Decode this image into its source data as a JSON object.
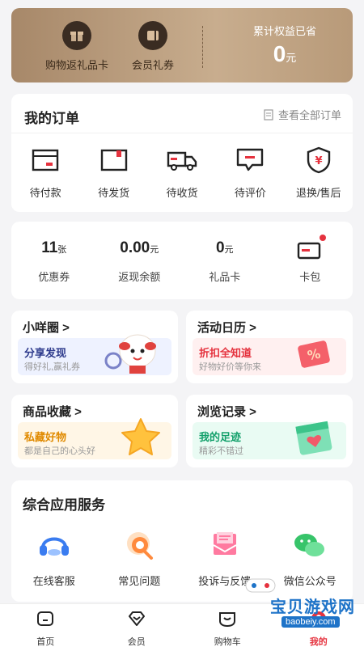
{
  "benefits": {
    "items": [
      {
        "label": "购物返礼品卡",
        "icon": "gift-icon"
      },
      {
        "label": "会员礼券",
        "icon": "coupon-icon"
      }
    ],
    "total_label": "累计权益已省",
    "total_value": "0",
    "total_unit": "元"
  },
  "orders": {
    "title": "我的订单",
    "view_all": "查看全部订单",
    "statuses": [
      {
        "label": "待付款",
        "icon": "wallet-icon"
      },
      {
        "label": "待发货",
        "icon": "package-icon"
      },
      {
        "label": "待收货",
        "icon": "truck-icon"
      },
      {
        "label": "待评价",
        "icon": "comment-icon"
      },
      {
        "label": "退换/售后",
        "icon": "shield-yen-icon"
      }
    ]
  },
  "assets": {
    "coupons": {
      "value": "11",
      "unit": "张",
      "label": "优惠券"
    },
    "cashback": {
      "value": "0.00",
      "unit": "元",
      "label": "返现余额"
    },
    "giftcard": {
      "value": "0",
      "unit": "元",
      "label": "礼品卡"
    },
    "wallet": {
      "label": "卡包"
    }
  },
  "tiles": [
    {
      "title": "小咩圈 >",
      "headline": "分享发现",
      "sub": "得好礼,赢礼券",
      "bg": "#eef2ff",
      "hcolor": "#2d3a8c"
    },
    {
      "title": "活动日历 >",
      "headline": "折扣全知道",
      "sub": "好物好价等你来",
      "bg": "#fff0f0",
      "hcolor": "#e5323e"
    },
    {
      "title": "商品收藏 >",
      "headline": "私藏好物",
      "sub": "都是自己的心头好",
      "bg": "#fff6e6",
      "hcolor": "#e08a00"
    },
    {
      "title": "浏览记录 >",
      "headline": "我的足迹",
      "sub": "精彩不错过",
      "bg": "#e9fbf3",
      "hcolor": "#13a06b"
    }
  ],
  "services": {
    "title": "综合应用服务",
    "items": [
      {
        "label": "在线客服",
        "icon": "headset-icon"
      },
      {
        "label": "常见问题",
        "icon": "faq-icon"
      },
      {
        "label": "投诉与反馈",
        "icon": "feedback-icon"
      },
      {
        "label": "微信公众号",
        "icon": "wechat-icon"
      }
    ]
  },
  "tabbar": {
    "items": [
      {
        "label": "首页",
        "icon": "home-icon"
      },
      {
        "label": "会员",
        "icon": "member-icon"
      },
      {
        "label": "购物车",
        "icon": "cart-icon"
      },
      {
        "label": "我的",
        "icon": "profile-icon"
      }
    ],
    "active_index": 3
  },
  "watermark": {
    "name": "宝贝游戏网",
    "url": "baobeiy.com"
  },
  "colors": {
    "accent": "#e5323e",
    "gold_bg": "#b89a79",
    "dark": "#3a2c22"
  }
}
